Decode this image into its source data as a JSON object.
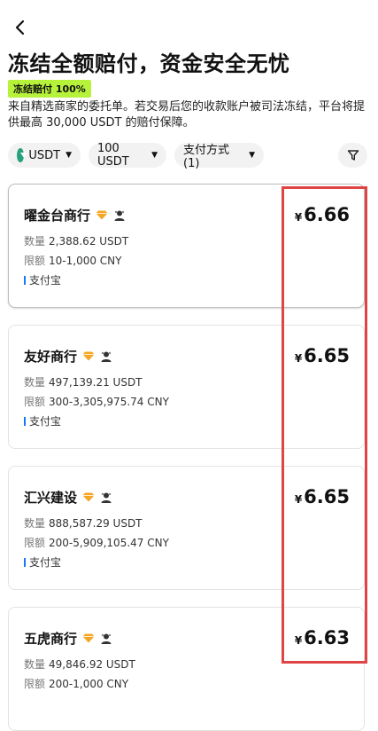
{
  "header": {
    "back_icon": "chevron-left-icon",
    "title": "冻结全额赔付，资金安全无忧",
    "badge": "冻结赔付 100%",
    "description": "来自精选商家的委托单。若交易后您的收款账户被司法冻结，平台将提供最高 30,000 USDT 的赔付保障。"
  },
  "filters": {
    "coin": "USDT",
    "coin_icon": "usdt-icon",
    "amount": "100 USDT",
    "payment": "支付方式 (1)",
    "filter_icon": "filter-icon"
  },
  "labels": {
    "quantity": "数量",
    "limit": "限额",
    "currency_symbol": "¥"
  },
  "merchants": [
    {
      "name": "曜金台商行",
      "quantity": "2,388.62 USDT",
      "limit": "10-1,000 CNY",
      "payment": "支付宝",
      "price": "6.66"
    },
    {
      "name": "友好商行",
      "quantity": "497,139.21 USDT",
      "limit": "300-3,305,975.74 CNY",
      "payment": "支付宝",
      "price": "6.65"
    },
    {
      "name": "汇兴建设",
      "quantity": "888,587.29 USDT",
      "limit": "200-5,909,105.47 CNY",
      "payment": "支付宝",
      "price": "6.65"
    },
    {
      "name": "五虎商行",
      "quantity": "49,846.92 USDT",
      "limit": "200-1,000 CNY",
      "payment": "",
      "price": "6.63"
    }
  ],
  "colors": {
    "badge": "#b7f23a",
    "diamond": "#f5a623",
    "highlight": "#e04545",
    "payment_bar": "#1677ff",
    "usdt": "#26a17b"
  }
}
